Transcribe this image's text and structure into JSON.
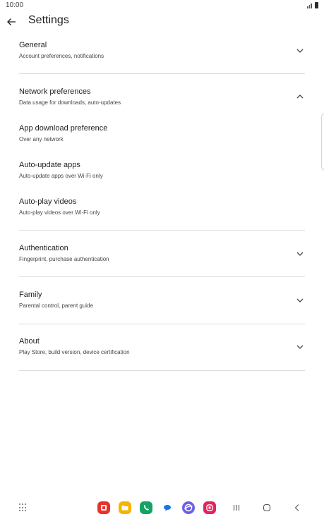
{
  "status_bar": {
    "time": "10:00"
  },
  "header": {
    "title": "Settings"
  },
  "sections": [
    {
      "title": "General",
      "subtitle": "Account preferences, notifications",
      "expanded": false
    },
    {
      "title": "Network preferences",
      "subtitle": "Data usage for downloads, auto-updates",
      "expanded": true,
      "items": [
        {
          "title": "App download preference",
          "subtitle": "Over any network"
        },
        {
          "title": "Auto-update apps",
          "subtitle": "Auto-update apps over Wi-Fi only"
        },
        {
          "title": "Auto-play videos",
          "subtitle": "Auto-play videos over Wi-Fi only"
        }
      ]
    },
    {
      "title": "Authentication",
      "subtitle": "Fingerprint, purchase authentication",
      "expanded": false
    },
    {
      "title": "Family",
      "subtitle": "Parental control, parent guide",
      "expanded": false
    },
    {
      "title": "About",
      "subtitle": "Play Store, build version, device certification",
      "expanded": false
    }
  ],
  "nav_bar": {
    "icons": [
      "apps-grid-icon",
      "app-red-icon",
      "folder-icon",
      "phone-icon",
      "messages-icon",
      "browser-icon",
      "camera-icon",
      "recents-icon",
      "home-icon",
      "back-icon"
    ],
    "dock_colors": [
      "#e8322a",
      "#f5b400",
      "#14a363",
      "#1a73e8",
      "#6b5fe6",
      "#e0245e"
    ]
  }
}
